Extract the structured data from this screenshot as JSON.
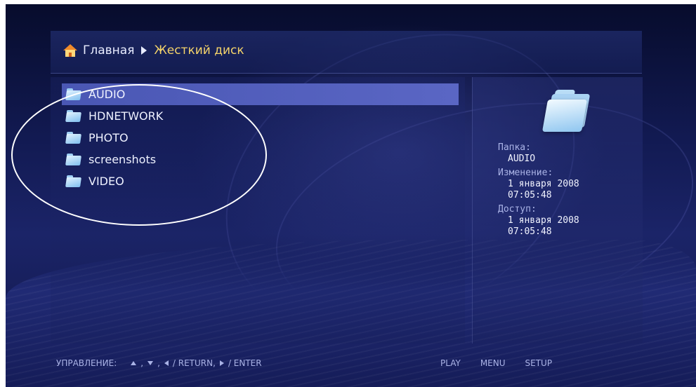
{
  "breadcrumb": {
    "home": "Главная",
    "current": "Жесткий диск"
  },
  "list": {
    "items": [
      {
        "label": "AUDIO",
        "selected": true
      },
      {
        "label": "HDNETWORK",
        "selected": false
      },
      {
        "label": "PHOTO",
        "selected": false
      },
      {
        "label": "screenshots",
        "selected": false
      },
      {
        "label": "VIDEO",
        "selected": false
      }
    ]
  },
  "info": {
    "folder_label": "Папка:",
    "folder_value": "AUDIO",
    "modified_label": "Изменение:",
    "modified_date": "1 января 2008",
    "modified_time": "07:05:48",
    "access_label": "Доступ:",
    "access_date": "1 января 2008",
    "access_time": "07:05:48"
  },
  "footer": {
    "control_label": "УПРАВЛЕНИЕ:",
    "return_label": "/ RETURN,",
    "enter_label": "/ ENTER",
    "play": "PLAY",
    "menu": "MENU",
    "setup": "SETUP"
  },
  "colors": {
    "accent": "#f4d36a",
    "selection": "#4a57b4",
    "text": "#eef1ff",
    "annotation": "#ffffff"
  }
}
